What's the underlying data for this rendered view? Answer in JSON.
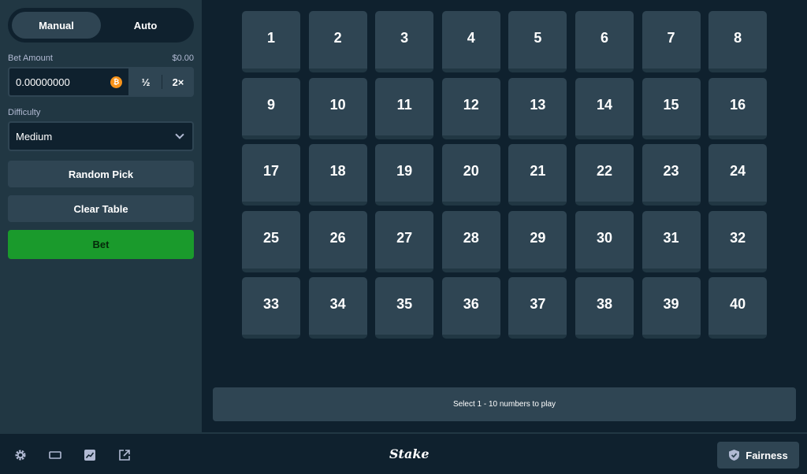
{
  "sidebar": {
    "tabs": [
      {
        "label": "Manual",
        "active": true
      },
      {
        "label": "Auto",
        "active": false
      }
    ],
    "bet_amount": {
      "label": "Bet Amount",
      "usd_value": "$0.00",
      "value": "0.00000000",
      "currency_icon": "bitcoin-icon",
      "half_label": "½",
      "double_label": "2×"
    },
    "difficulty": {
      "label": "Difficulty",
      "selected": "Medium"
    },
    "random_pick_label": "Random Pick",
    "clear_table_label": "Clear Table",
    "bet_label": "Bet"
  },
  "board": {
    "tiles": [
      "1",
      "2",
      "3",
      "4",
      "5",
      "6",
      "7",
      "8",
      "9",
      "10",
      "11",
      "12",
      "13",
      "14",
      "15",
      "16",
      "17",
      "18",
      "19",
      "20",
      "21",
      "22",
      "23",
      "24",
      "25",
      "26",
      "27",
      "28",
      "29",
      "30",
      "31",
      "32",
      "33",
      "34",
      "35",
      "36",
      "37",
      "38",
      "39",
      "40"
    ],
    "info_text": "Select 1 - 10 numbers to play"
  },
  "footer": {
    "icons": [
      "gear-icon",
      "theatre-mode-icon",
      "stats-icon",
      "popout-icon"
    ],
    "logo": "Stake",
    "fairness_label": "Fairness"
  },
  "colors": {
    "background": "#0f212e",
    "panel": "#213743",
    "tile": "#2f4553",
    "bet_green": "#1a9a2c",
    "bitcoin": "#f7931a"
  }
}
